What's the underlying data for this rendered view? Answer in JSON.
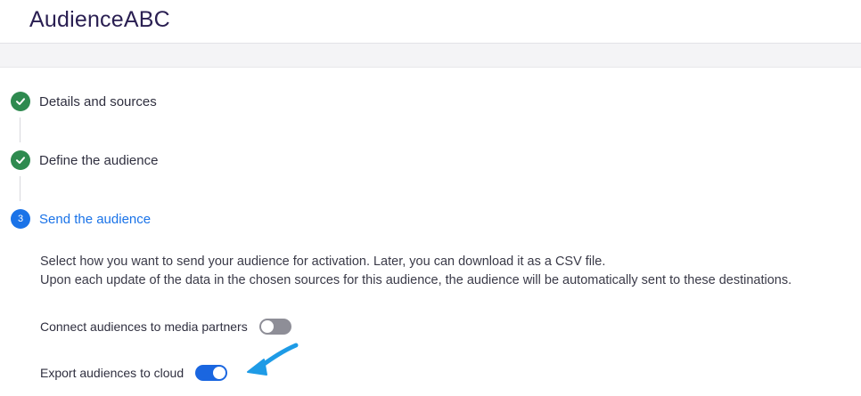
{
  "app": {
    "title": "AudienceABC"
  },
  "steps": [
    {
      "number": "",
      "label": "Details and sources",
      "status": "completed",
      "icon": "check-icon"
    },
    {
      "number": "",
      "label": "Define the audience",
      "status": "completed",
      "icon": "check-icon"
    },
    {
      "number": "3",
      "label": "Send the audience",
      "status": "active"
    }
  ],
  "send_section": {
    "description_line1": "Select how you want to send your audience for activation. Later, you can download it as a CSV file.",
    "description_line2": "Upon each update of the data in the chosen sources for this audience, the audience will be automatically sent to these destinations.",
    "options": [
      {
        "label": "Connect audiences to media partners",
        "enabled": false
      },
      {
        "label": "Export audiences to cloud",
        "enabled": true
      }
    ]
  },
  "colors": {
    "completed": "#2e8a4f",
    "active": "#1a73e8",
    "toggle_on": "#1a66e0",
    "toggle_off": "#8e8e97",
    "title": "#2a1f52",
    "annotation_arrow": "#1e9be6"
  }
}
